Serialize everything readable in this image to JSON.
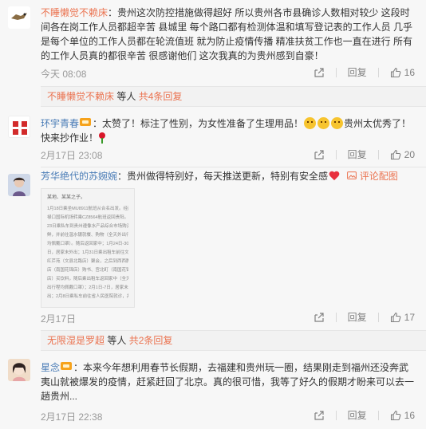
{
  "comments": [
    {
      "user": "不睡懒觉不赖床",
      "content_lines": [
        "：贵州这次防控措施做得超好 所以贵州各市县确诊人数相对较少 这段时",
        "间各在岗工作人员都超辛苦 县城里 每个路口都有检测体温和填写登记表的工作人员 几乎",
        "是每个单位的工作人员都在轮流值班 就为防止疫情传播 精准扶贫工作也一直在进行 所有",
        "的工作人员真的都很辛苦 很感谢他们 这次我真的为贵州感到自豪！"
      ],
      "time": "今天 08:08",
      "reply_label": "回复",
      "like_count": "16",
      "replies": {
        "user": "不睡懒觉不赖床",
        "mid": " 等人 ",
        "link": "共4条回复"
      }
    },
    {
      "user": "环宇青春",
      "content_a": "：太赞了！标注了性别，为女性准备了生理用品！",
      "content_b": "贵州太优秀了！",
      "content_line2": "快来抄作业！",
      "time": "2月17日 23:08",
      "reply_label": "回复",
      "like_count": "20"
    },
    {
      "user": "芳华绝代的苏婉婉",
      "content": "：贵州做得特别好，每天推送更新，特别有安全感",
      "review_pic_label": "评论配图",
      "time": "2月17日",
      "reply_label": "回复",
      "like_count": "17",
      "replies": {
        "user": "无限湿是罗超",
        "mid": " 等人 ",
        "link": "共2条回复"
      },
      "pic_title": "某地、某某之子。",
      "pic_lines": [
        "1月18日乘坐MU8911航班从合名出发。经南京",
        "禄口国际机场转乘CZ8564航班返回贵阳。1月",
        "23日乘私车到贵州遵像水产品综合市场购买海",
        "鲜，并前往温水镀就餐、购物（全天外出行程",
        "均佩戴口罩）。随后返回家中；1月24日-30",
        "日，居家未外出；1月31日乘出租车前往文一间",
        "红芹苑（文县北路店）聚会，之后到西西腾书",
        "店（南国花锦店）购书、宫北町（南国花锦",
        "店）买饮料，随后乘出租车返回家中（全天外",
        "出行程均佩戴口罩）；2月1日-7日，居家未外",
        "出；2月8日乘私车前往省人民医院就诊，并进"
      ]
    },
    {
      "user": "星念",
      "content_lines": [
        "：本来今年想利用春节长假期，去福建和贵州玩一圈，结果刚走到福州还没奔武",
        "夷山就被爆发的疫情，赶紧赶回了北京。真的很可惜，我等了好久的假期才盼来可以去一",
        "趟贵州..."
      ],
      "time": "2月17日 22:38",
      "reply_label": "回复",
      "like_count": "16"
    }
  ],
  "colors": {
    "link": "#eb7350",
    "blue": "#4a7cb6",
    "muted": "#999999"
  },
  "icons": [
    "share-icon",
    "comment-icon",
    "like-icon",
    "picture-icon"
  ]
}
